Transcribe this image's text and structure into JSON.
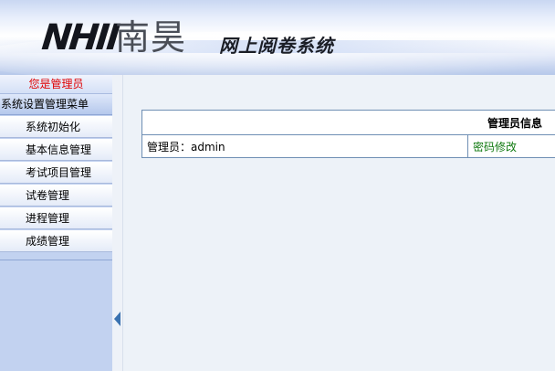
{
  "header": {
    "logo_mark": "NHII",
    "logo_cn": "南昊",
    "system_title": "网上阅卷系统"
  },
  "sidebar": {
    "role_banner": "您是管理员",
    "menu_header": "系统设置管理菜单",
    "items": [
      {
        "label": "系统初始化"
      },
      {
        "label": "基本信息管理"
      },
      {
        "label": "考试项目管理"
      },
      {
        "label": "试卷管理"
      },
      {
        "label": "进程管理"
      },
      {
        "label": "成绩管理"
      }
    ]
  },
  "main": {
    "table_title": "管理员信息",
    "admin_label": "管理员：admin",
    "change_password_link": "密码修改"
  },
  "colors": {
    "sidebar_bg": "#c2d2f0",
    "warning_text": "#e00000",
    "link_text": "#117a11",
    "table_border": "#6f8fb4"
  }
}
